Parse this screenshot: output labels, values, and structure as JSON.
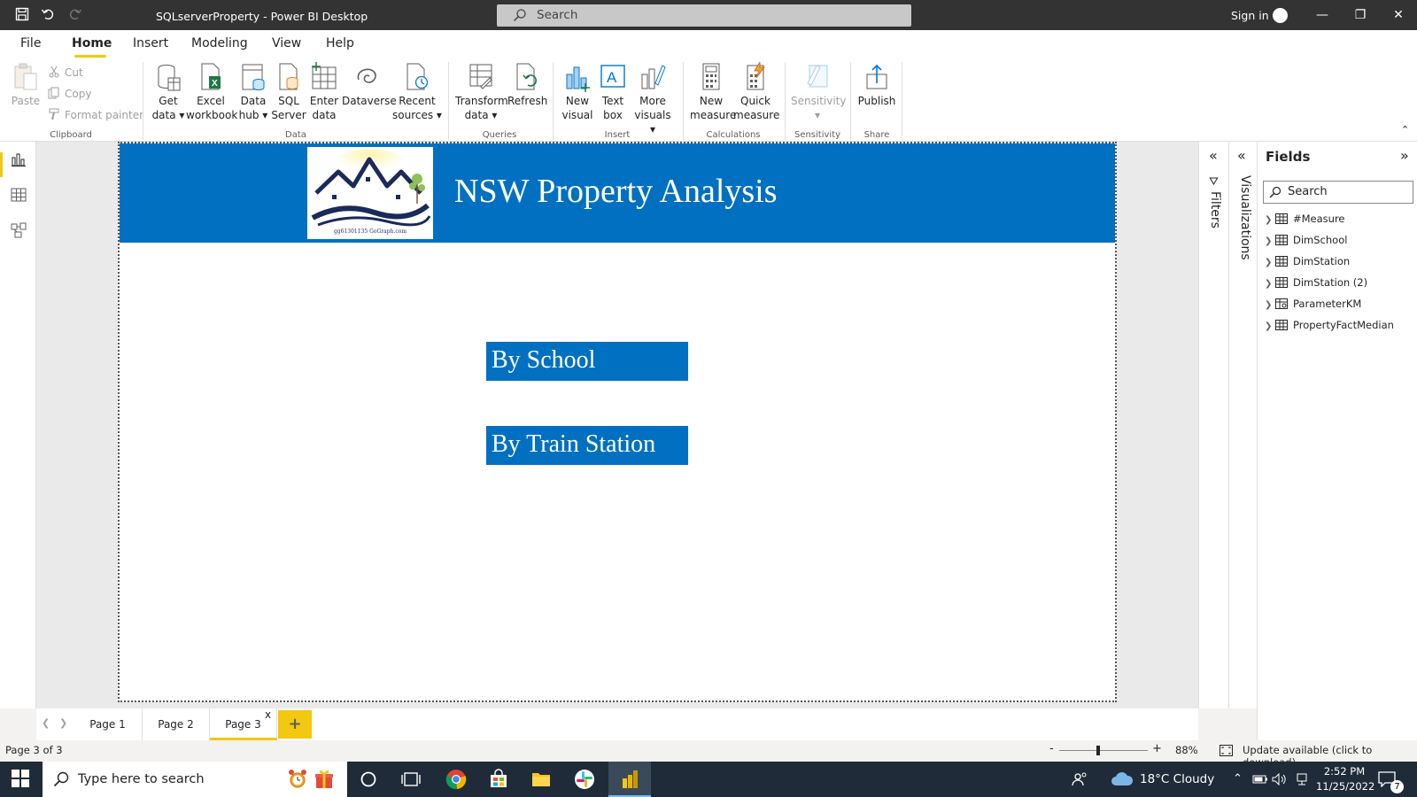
{
  "titlebar": {
    "app_title": "SQLserverProperty - Power BI Desktop",
    "search_placeholder": "Search",
    "sign_in": "Sign in",
    "minimize": "—",
    "restore": "❐",
    "close": "✕"
  },
  "menu": {
    "tabs": [
      "File",
      "Home",
      "Insert",
      "Modeling",
      "View",
      "Help"
    ],
    "active": "Home"
  },
  "ribbon": {
    "clipboard": {
      "paste": "Paste",
      "cut": "Cut",
      "copy": "Copy",
      "format_painter": "Format painter",
      "label": "Clipboard"
    },
    "data": {
      "get_data": [
        "Get",
        "data ▾"
      ],
      "excel": [
        "Excel",
        "workbook"
      ],
      "data_hub": [
        "Data",
        "hub ▾"
      ],
      "sql_server": [
        "SQL",
        "Server"
      ],
      "enter_data": [
        "Enter",
        "data"
      ],
      "dataverse": [
        "Dataverse",
        ""
      ],
      "recent_sources": [
        "Recent",
        "sources ▾"
      ],
      "label": "Data"
    },
    "queries": {
      "transform": [
        "Transform",
        "data ▾"
      ],
      "refresh": [
        "Refresh",
        ""
      ],
      "label": "Queries"
    },
    "insert": {
      "new_visual": [
        "New",
        "visual"
      ],
      "text_box": [
        "Text",
        "box"
      ],
      "more_visuals": [
        "More",
        "visuals ▾"
      ],
      "label": "Insert"
    },
    "calculations": {
      "new_measure": [
        "New",
        "measure"
      ],
      "quick_measure": [
        "Quick",
        "measure"
      ],
      "label": "Calculations"
    },
    "sensitivity": {
      "sensitivity": [
        "Sensitivity",
        "▾"
      ],
      "label": "Sensitivity"
    },
    "share": {
      "publish": [
        "Publish",
        ""
      ],
      "label": "Share"
    }
  },
  "report": {
    "title": "NSW Property Analysis",
    "logo_caption": "gg61301135 GoGraph.com",
    "buttons": [
      "By School",
      "By Train Station"
    ],
    "header_color": "#0170c1"
  },
  "panes": {
    "filters_label": "Filters",
    "visualizations_label": "Visualizations",
    "fields_title": "Fields",
    "fields_search": "Search",
    "fields": [
      "#Measure",
      "DimSchool",
      "DimStation",
      "DimStation (2)",
      "ParameterKM",
      "PropertyFactMedian"
    ]
  },
  "pages": {
    "tabs": [
      "Page 1",
      "Page 2",
      "Page 3"
    ],
    "active": "Page 3",
    "close": "x",
    "add": "+"
  },
  "status": {
    "page_count": "Page 3 of 3",
    "zoom_minus": "-",
    "zoom_plus": "+",
    "zoom_level": "88%",
    "zoom_fraction": 0.44,
    "update": "Update available (click to download)"
  },
  "taskbar": {
    "search_placeholder": "Type here to search",
    "weather": "18°C  Cloudy",
    "time": "2:52 PM",
    "date": "11/25/2022",
    "notifications": "7"
  },
  "colors": {
    "accent": "#f2c811",
    "brand_blue": "#0170c1",
    "titlebar": "#333333",
    "taskbar": "#1f2b38"
  }
}
